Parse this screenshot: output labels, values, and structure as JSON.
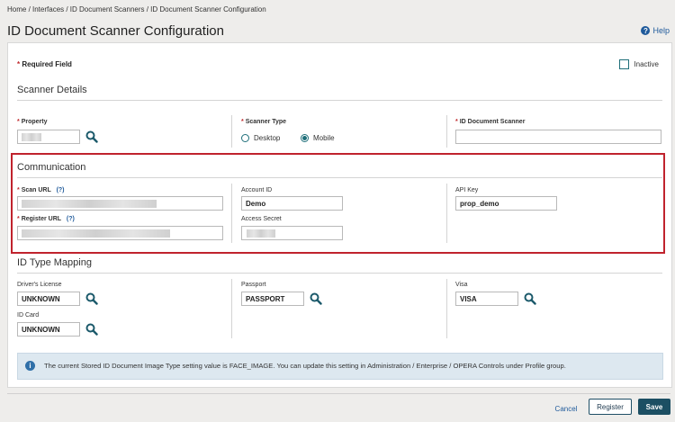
{
  "breadcrumb": "Home / Interfaces / ID Document Scanners / ID Document Scanner Configuration",
  "page_title": "ID Document Scanner Configuration",
  "help_label": "Help",
  "required_note": "Required Field",
  "required_star": "*",
  "inactive_label": "Inactive",
  "scanner_details": {
    "title": "Scanner Details",
    "property_label": "Property",
    "scanner_type_label": "Scanner Type",
    "desktop_label": "Desktop",
    "mobile_label": "Mobile",
    "id_scanner_label": "ID Document Scanner"
  },
  "communication": {
    "title": "Communication",
    "scan_url_label": "Scan URL",
    "register_url_label": "Register URL",
    "help_hint": "(?)",
    "account_id_label": "Account ID",
    "account_id_value": "Demo",
    "access_secret_label": "Access Secret",
    "api_key_label": "API Key",
    "api_key_value": "prop_demo"
  },
  "mapping": {
    "title": "ID Type Mapping",
    "drivers_license_label": "Driver's License",
    "drivers_license_value": "UNKNOWN",
    "passport_label": "Passport",
    "passport_value": "PASSPORT",
    "visa_label": "Visa",
    "visa_value": "VISA",
    "id_card_label": "ID Card",
    "id_card_value": "UNKNOWN"
  },
  "info_text": "The current Stored ID Document Image Type setting value is FACE_IMAGE. You can update this setting in Administration / Enterprise / OPERA Controls under Profile group.",
  "buttons": {
    "cancel": "Cancel",
    "register": "Register",
    "save": "Save"
  },
  "colors": {
    "accent": "#1c4f63",
    "required": "#c0292d",
    "highlight_border": "#c0232d",
    "info_bg": "#dde8f0"
  }
}
